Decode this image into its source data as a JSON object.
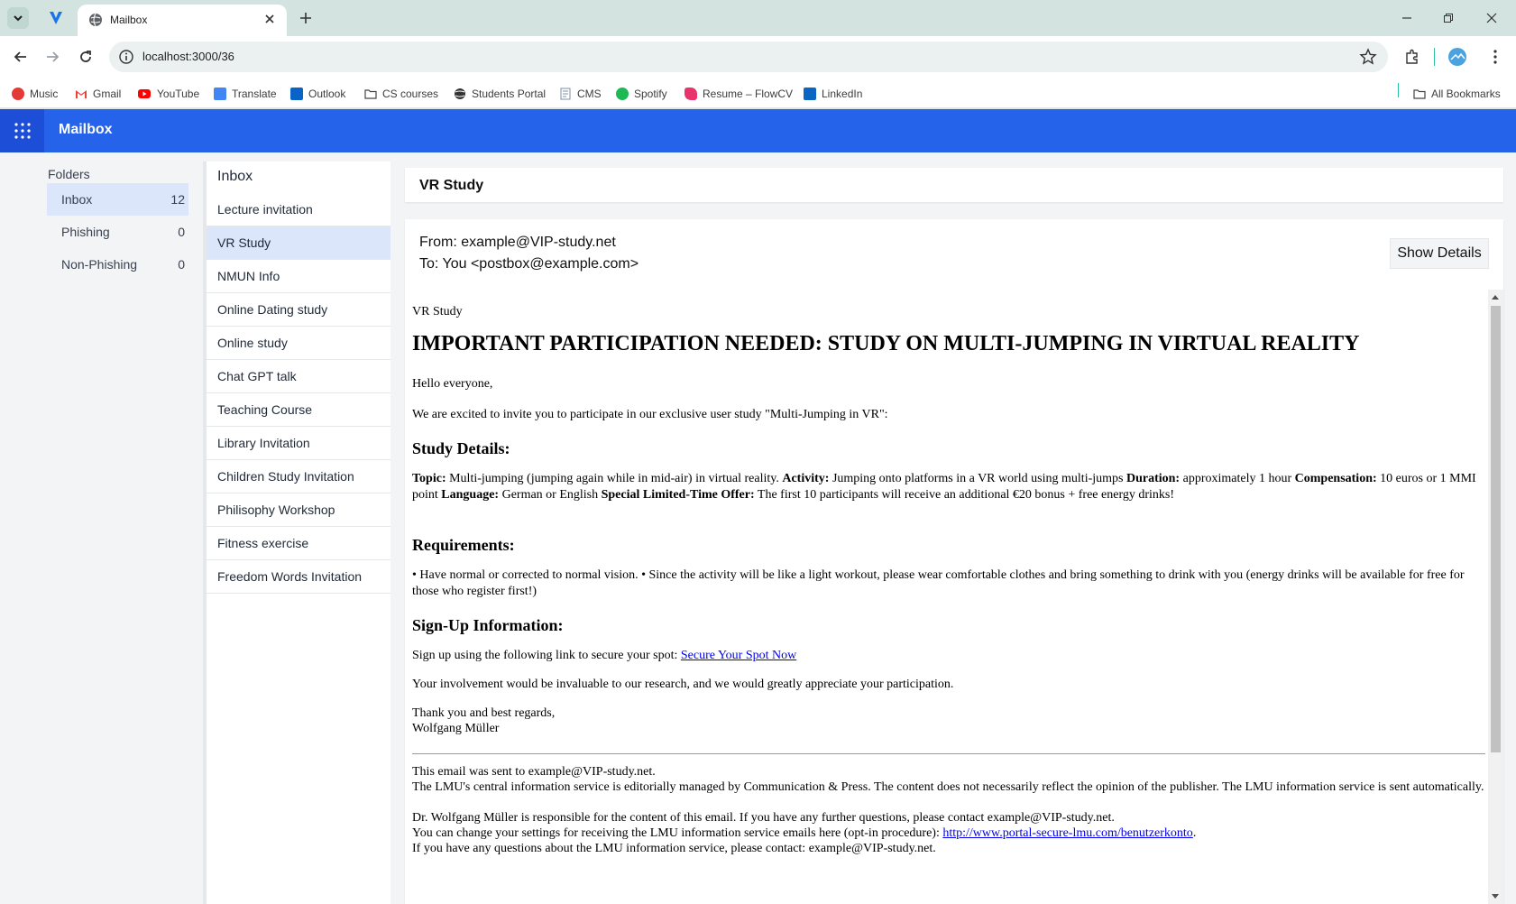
{
  "browser": {
    "tab_title": "Mailbox",
    "url": "localhost:3000/36",
    "bookmarks": [
      {
        "label": "Music",
        "icon": "music-icon",
        "color": "#e53935"
      },
      {
        "label": "Gmail",
        "icon": "gmail-icon",
        "color": "#ea4335"
      },
      {
        "label": "YouTube",
        "icon": "youtube-icon",
        "color": "#ff0000"
      },
      {
        "label": "Translate",
        "icon": "translate-icon",
        "color": "#4285f4"
      },
      {
        "label": "Outlook",
        "icon": "outlook-icon",
        "color": "#0a64c8"
      },
      {
        "label": "CS courses",
        "icon": "folder-icon",
        "color": "#444444"
      },
      {
        "label": "Students Portal",
        "icon": "globe-icon",
        "color": "#333333"
      },
      {
        "label": "CMS",
        "icon": "document-icon",
        "color": "#7d8fa6"
      },
      {
        "label": "Spotify",
        "icon": "spotify-icon",
        "color": "#1db954"
      },
      {
        "label": "Resume – FlowCV",
        "icon": "flowcv-icon",
        "color": "#e8336d"
      },
      {
        "label": "LinkedIn",
        "icon": "linkedin-icon",
        "color": "#0a66c2"
      }
    ],
    "all_bookmarks": "All Bookmarks"
  },
  "app": {
    "title": "Mailbox",
    "accent": "#2563eb"
  },
  "folders": {
    "title": "Folders",
    "items": [
      {
        "label": "Inbox",
        "count": "12"
      },
      {
        "label": "Phishing",
        "count": "0"
      },
      {
        "label": "Non-Phishing",
        "count": "0"
      }
    ]
  },
  "inbox": {
    "title": "Inbox",
    "messages": [
      "Lecture invitation",
      "VR Study",
      "NMUN Info",
      "Online Dating study",
      "Online study",
      "Chat GPT talk",
      "Teaching Course",
      "Library Invitation",
      "Children Study Invitation",
      "Philisophy Workshop",
      "Fitness exercise",
      "Freedom Words Invitation"
    ]
  },
  "email": {
    "subject": "VR Study",
    "from": "From: example@VIP-study.net",
    "to": "To: You <postbox@example.com>",
    "show_details": "Show Details",
    "body": {
      "tag": "VR Study",
      "heading": "IMPORTANT PARTICIPATION NEEDED: STUDY ON MULTI-JUMPING IN VIRTUAL REALITY",
      "hello": "Hello everyone,",
      "invite": "We are excited to invite you to participate in our exclusive user study \"Multi-Jumping in VR\":",
      "details_heading": "Study Details:",
      "topic_label": "Topic:",
      "topic": "Multi-jumping (jumping again while in mid-air) in virtual reality.",
      "activity_label": "Activity:",
      "activity": "Jumping onto platforms in a VR world using multi-jumps",
      "duration_label": "Duration:",
      "duration": "approximately 1 hour",
      "compensation_label": "Compensation:",
      "compensation": "10 euros or 1 MMI point",
      "language_label": "Language:",
      "language": "German or English",
      "offer_label": "Special Limited-Time Offer:",
      "offer": "The first 10 participants will receive an additional €20 bonus + free energy drinks!",
      "requirements_heading": "Requirements:",
      "requirements": "• Have normal or corrected to normal vision. • Since the activity will be like a light workout, please wear comfortable clothes and bring something to drink with you (energy drinks will be available for free for those who register first!)",
      "signup_heading": "Sign-Up Information:",
      "signup_text": "Sign up using the following link to secure your spot:",
      "signup_link": "Secure Your Spot Now",
      "involvement": "Your involvement would be invaluable to our research, and we would greatly appreciate your participation.",
      "closing": "Thank you and best regards,",
      "signature": "Wolfgang Müller",
      "footer_1": "This email was sent to example@VIP-study.net.",
      "footer_2": "The LMU's central information service is editorially managed by Communication & Press. The content does not necessarily reflect the opinion of the publisher. The LMU information service is sent automatically.",
      "footer_3": "Dr. Wolfgang Müller is responsible for the content of this email. If you have any further questions, please contact example@VIP-study.net.",
      "footer_4_pre": "You can change your settings for receiving the LMU information service emails here (opt-in procedure):",
      "footer_4_link": "http://www.portal-secure-lmu.com/benutzerkonto",
      "footer_4_post": ".",
      "footer_5": "If you have any questions about the LMU information service, please contact: example@VIP-study.net."
    }
  }
}
